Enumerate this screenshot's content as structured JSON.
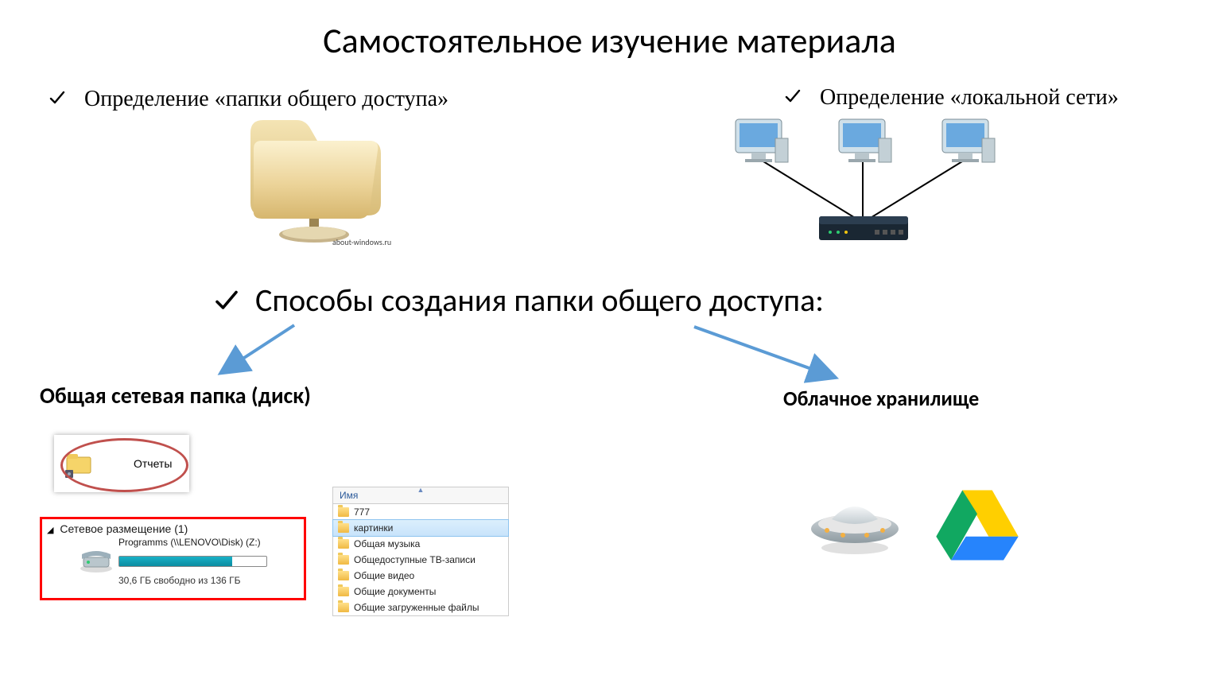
{
  "title": "Самостоятельное изучение материала",
  "left_def": "Определение «папки общего доступа»",
  "right_def": "Определение «локальной сети»",
  "caption_aboutwin": "about-windows.ru",
  "ways_heading": "Способы создания папки общего доступа:",
  "left_sub": "Общая сетевая папка (диск)",
  "right_sub": "Облачное хранилище",
  "report_label": "Отчеты",
  "netloc": {
    "header": "Сетевое размещение (1)",
    "drive_label": "Programms (\\\\LENOVO\\Disk) (Z:)",
    "space_text": "30,6 ГБ свободно из 136 ГБ"
  },
  "flist": {
    "col": "Имя",
    "rows": [
      "777",
      "картинки",
      "Общая музыка",
      "Общедоступные ТВ-записи",
      "Общие видео",
      "Общие документы",
      "Общие загруженные файлы"
    ],
    "selected_index": 1
  }
}
